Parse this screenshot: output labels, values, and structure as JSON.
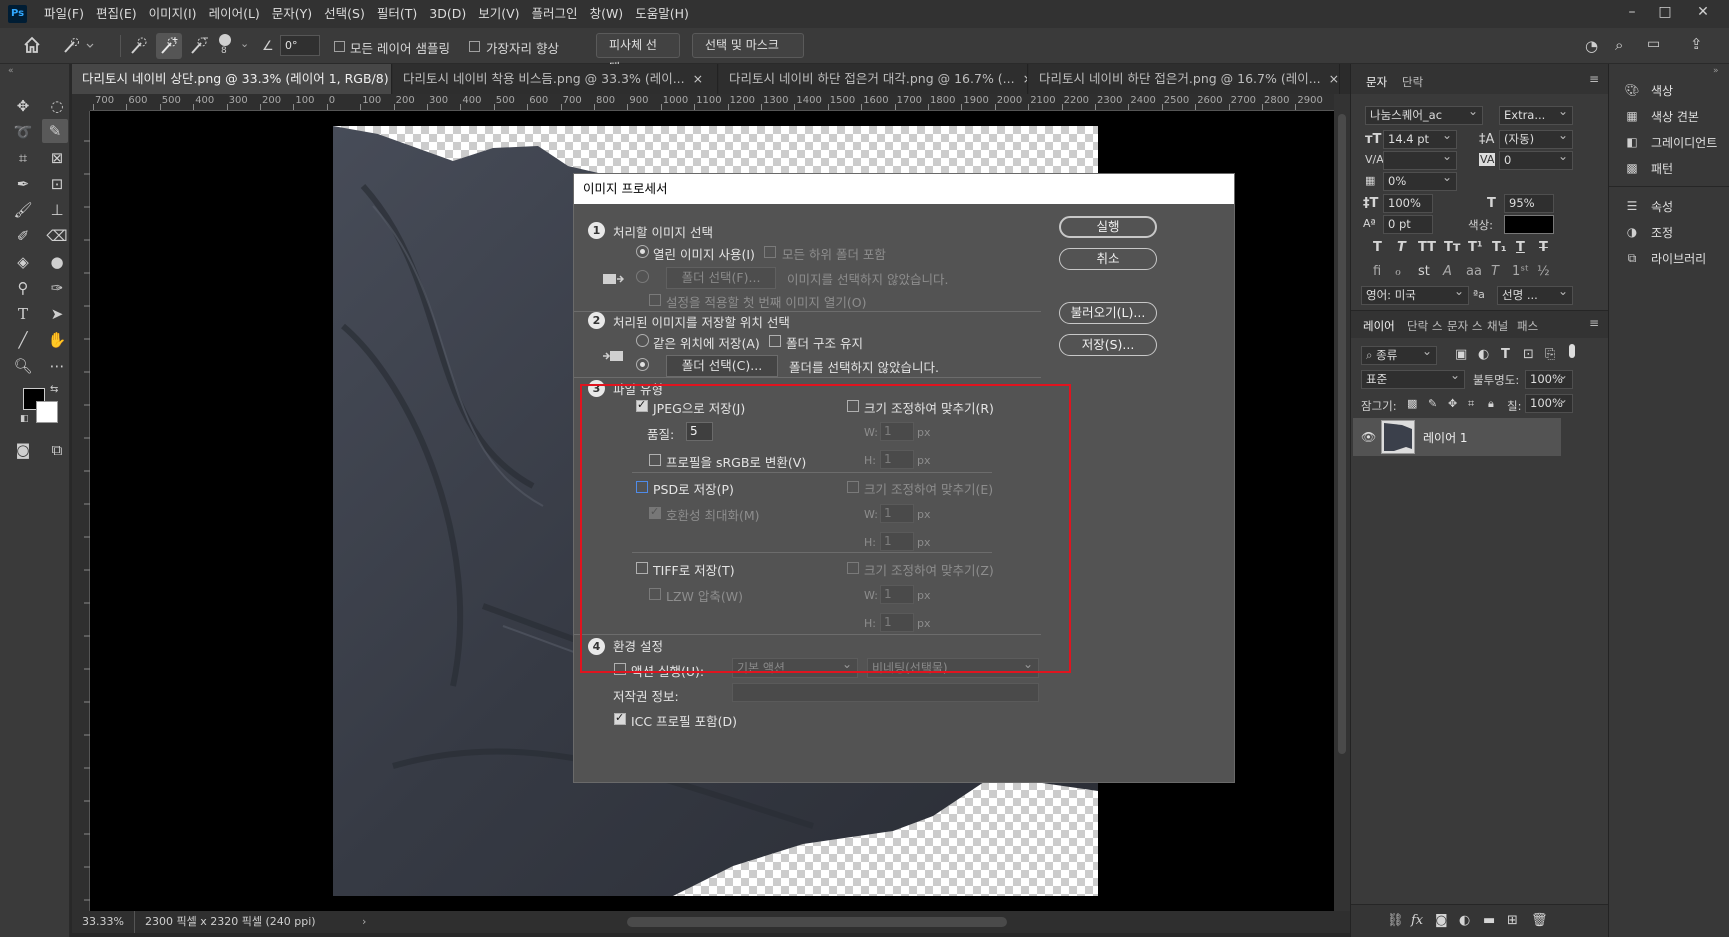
{
  "app": {
    "logo": "Ps",
    "menu": [
      "파일(F)",
      "편집(E)",
      "이미지(I)",
      "레이어(L)",
      "문자(Y)",
      "선택(S)",
      "필터(T)",
      "3D(D)",
      "보기(V)",
      "플러그인",
      "창(W)",
      "도움말(H)"
    ]
  },
  "options": {
    "brush_size": "8",
    "angle_value": "0°",
    "sample_all_label": "모든 레이어 샘플링",
    "enhance_edge_label": "가장자리 향상",
    "select_subject_label": "피사체 선택",
    "select_mask_label": "선택 및 마스크 ..."
  },
  "tabs": [
    {
      "label": "다리토시 네이비 상단.png @ 33.3% (레이어 1, RGB/8)",
      "close": "×"
    },
    {
      "label": "다리토시 네이비 착용 비스듬.png @ 33.3% (레이...",
      "close": "×"
    },
    {
      "label": "다리토시 네이비 하단 접은거 대각.png @ 16.7% (...",
      "close": "×"
    },
    {
      "label": "다리토시 네이비 하단 접은거.png @ 16.7% (레이...",
      "close": "×"
    }
  ],
  "ruler": {
    "h_labels": [
      "700",
      "600",
      "500",
      "400",
      "300",
      "200",
      "100",
      "0",
      "100",
      "200",
      "300",
      "400",
      "500",
      "600",
      "700",
      "800",
      "900",
      "1000",
      "1100",
      "1200",
      "1300",
      "1400",
      "1500",
      "1600",
      "1700",
      "1800",
      "1900",
      "2000",
      "2100",
      "2200",
      "2300",
      "2400",
      "2500",
      "2600",
      "2700",
      "2800",
      "2900"
    ]
  },
  "status": {
    "zoom": "33.33%",
    "doc_info": "2300 픽셀 x 2320 픽셀 (240 ppi)",
    "arrow": "›"
  },
  "dialog": {
    "title": "이미지 프로세서",
    "step1": {
      "num": "1",
      "title": "처리할 이미지 선택",
      "use_open": "열린 이미지 사용(I)",
      "include_sub": "모든 하위 폴더 포함",
      "folder_btn": "폴더 선택(F)...",
      "no_image": "이미지를 선택하지 않았습니다.",
      "open_first": "설정을 적용할 첫 번째 이미지 열기(O)"
    },
    "step2": {
      "num": "2",
      "title": "처리된 이미지를 저장할 위치 선택",
      "same_loc": "같은 위치에 저장(A)",
      "keep_struct": "폴더 구조 유지",
      "folder_btn": "폴더 선택(C)...",
      "no_folder": "폴더를 선택하지 않았습니다."
    },
    "step3": {
      "num": "3",
      "title": "파일 유형",
      "jpeg": "JPEG으로 저장(J)",
      "resize1": "크기 조정하여 맞추기(R)",
      "quality_label": "품질:",
      "quality_value": "5",
      "w": "W:",
      "h": "H:",
      "w_val": "1",
      "px": "px",
      "srgb": "프로필을 sRGB로 변환(V)",
      "psd": "PSD로 저장(P)",
      "resize2": "크기 조정하여 맞추기(E)",
      "max_compat": "호환성 최대화(M)",
      "tiff": "TIFF로 저장(T)",
      "resize3": "크기 조정하여 맞추기(Z)",
      "lzw": "LZW 압축(W)"
    },
    "step4": {
      "num": "4",
      "title": "환경 설정",
      "run_action": "액션 실행(U):",
      "action_set": "기본 액션",
      "action": "비네팅(선택물)",
      "copyright": "저작권 정보:",
      "icc": "ICC 프로필 포함(D)"
    },
    "buttons": {
      "run": "실행",
      "cancel": "취소",
      "load": "불러오기(L)...",
      "save": "저장(S)..."
    }
  },
  "char_panel": {
    "tabs": [
      "문자",
      "단락"
    ],
    "font": "나눔스퀘어_ac",
    "style": "Extra...",
    "size": "14.4 pt",
    "leading": "(자동)",
    "kerning": "",
    "tracking": "0",
    "tsume": "0%",
    "vscale": "100%",
    "hscale": "95%",
    "baseline": "0 pt",
    "color_label": "색상:",
    "language": "영어: 미국",
    "aa_label": "ªa",
    "aa_value": "선명 ...",
    "color_swatch": "#000000"
  },
  "layers_panel": {
    "tabs": [
      "레이어",
      "단락 스",
      "문자 스",
      "채널",
      "패스"
    ],
    "filter": "종류",
    "blend": "표준",
    "opacity_label": "불투명도:",
    "opacity": "100%",
    "lock_label": "잠그기:",
    "fill_label": "칠:",
    "fill": "100%",
    "layer_name": "레이어 1"
  },
  "dock": {
    "group1": [
      "색상",
      "색상 견본",
      "그레이디언트",
      "패턴"
    ],
    "group2": [
      "속성",
      "조정",
      "라이브러리"
    ]
  },
  "colors": {
    "accent_red": "#e0141f",
    "fabric": "#3b404b"
  }
}
